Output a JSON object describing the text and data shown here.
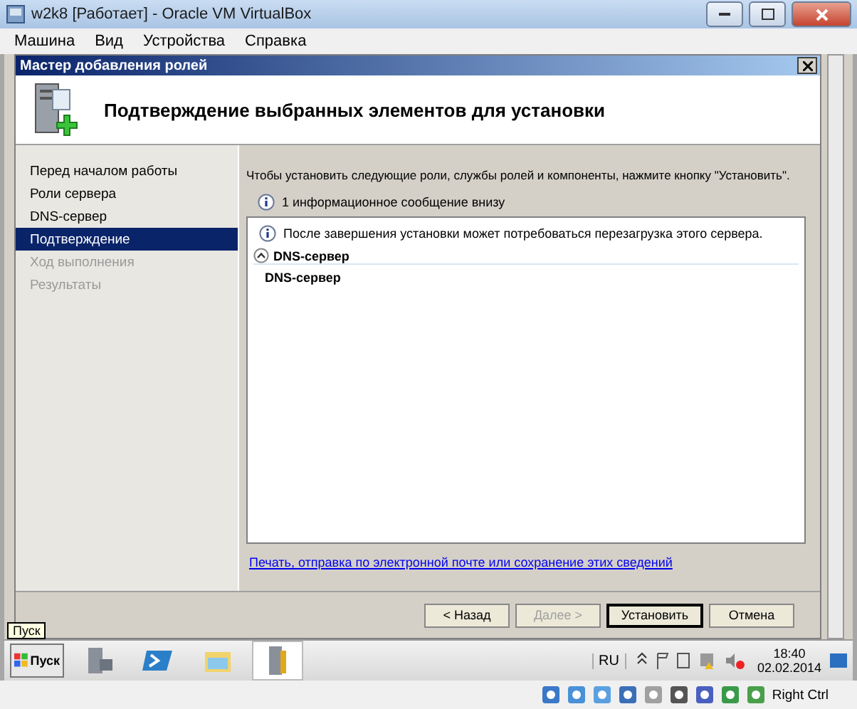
{
  "window": {
    "title": "w2k8 [Работает] - Oracle VM VirtualBox"
  },
  "menu": [
    "Машина",
    "Вид",
    "Устройства",
    "Справка"
  ],
  "wizard": {
    "title": "Мастер добавления ролей",
    "heading": "Подтверждение выбранных элементов для установки",
    "steps": [
      {
        "label": "Перед началом работы",
        "selected": false,
        "disabled": false
      },
      {
        "label": "Роли сервера",
        "selected": false,
        "disabled": false
      },
      {
        "label": "DNS-сервер",
        "selected": false,
        "disabled": false
      },
      {
        "label": "Подтверждение",
        "selected": true,
        "disabled": false
      },
      {
        "label": "Ход выполнения",
        "selected": false,
        "disabled": true
      },
      {
        "label": "Результаты",
        "selected": false,
        "disabled": true
      }
    ],
    "intro": "Чтобы установить следующие роли, службы ролей и компоненты, нажмите кнопку \"Установить\".",
    "info_summary": "1 информационное сообщение внизу",
    "details": {
      "message": "После завершения установки может потребоваться перезагрузка этого сервера.",
      "section": {
        "title": "DNS-сервер",
        "expanded": true,
        "items": [
          "DNS-сервер"
        ]
      }
    },
    "link": "Печать, отправка по электронной почте или сохранение этих сведений",
    "buttons": [
      {
        "label": "< Назад",
        "disabled": false,
        "default": false
      },
      {
        "label": "Далее >",
        "disabled": true,
        "default": false
      },
      {
        "label": "Установить",
        "disabled": false,
        "default": true
      },
      {
        "label": "Отмена",
        "disabled": false,
        "default": false
      }
    ]
  },
  "tooltip": "Пуск",
  "taskbar": {
    "start": "Пуск",
    "language": "RU",
    "time": "18:40",
    "date": "02.02.2014"
  },
  "status_bar": {
    "host_key": "Right Ctrl"
  }
}
